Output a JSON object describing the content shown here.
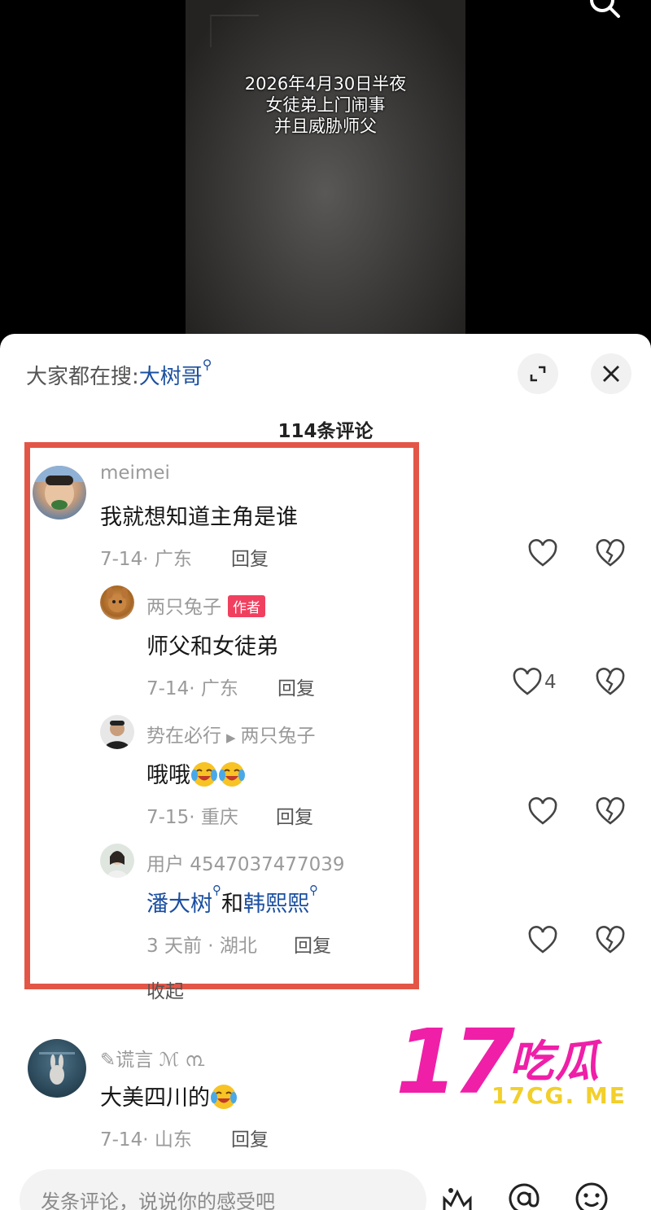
{
  "video": {
    "caption_lines": [
      "2026年4月30日半夜",
      "女徒弟上门闹事",
      "并且威胁师父"
    ]
  },
  "search_hint": {
    "prefix": "大家都在搜:",
    "term": "大树哥"
  },
  "comment_count": "114条评论",
  "comments": [
    {
      "user": "meimei",
      "text": "我就想知道主角是谁",
      "date_location": "7-14· 广东",
      "reply_label": "回复",
      "replies": [
        {
          "user": "两只兔子",
          "badge": "作者",
          "text": "师父和女徒弟",
          "date_location": "7-14· 广东",
          "reply_label": "回复",
          "likes": "4"
        },
        {
          "user": "势在必行",
          "reply_to": "两只兔子",
          "text": "哦哦",
          "date_location": "7-15· 重庆",
          "reply_label": "回复"
        },
        {
          "user": "用户 4547037477039",
          "text_link1": "潘大树",
          "text_mid": "和",
          "text_link2": "韩熙熙",
          "date_location": "3 天前 · 湖北",
          "reply_label": "回复"
        }
      ],
      "collapse_label": "收起"
    },
    {
      "user": "✎谎言 ℳ ൩ ",
      "text": "大美四川的",
      "date_location": "7-14· 山东",
      "reply_label": "回复"
    }
  ],
  "input": {
    "placeholder": "发条评论，说说你的感受吧"
  },
  "watermark": {
    "number": "17",
    "name": "吃瓜",
    "url": "17CG. ME"
  },
  "icons": [
    "search-icon",
    "expand-icon",
    "close-icon",
    "heart-icon",
    "broken-heart-icon",
    "image-icon",
    "at-icon",
    "emoji-icon"
  ],
  "colors": {
    "highlight_border": "#e35647",
    "link": "#1b4fa0",
    "author_badge": "#f0405f",
    "watermark_pink": "#ef1fa8",
    "watermark_yellow": "#f2cf2a"
  }
}
